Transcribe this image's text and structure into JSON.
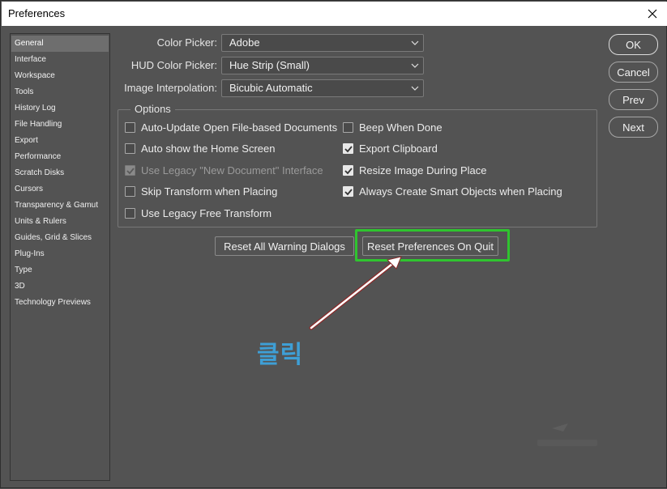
{
  "window": {
    "title": "Preferences"
  },
  "sidebar": {
    "items": [
      {
        "label": "General",
        "selected": true
      },
      {
        "label": "Interface"
      },
      {
        "label": "Workspace"
      },
      {
        "label": "Tools"
      },
      {
        "label": "History Log"
      },
      {
        "label": "File Handling"
      },
      {
        "label": "Export"
      },
      {
        "label": "Performance"
      },
      {
        "label": "Scratch Disks"
      },
      {
        "label": "Cursors"
      },
      {
        "label": "Transparency & Gamut"
      },
      {
        "label": "Units & Rulers"
      },
      {
        "label": "Guides, Grid & Slices"
      },
      {
        "label": "Plug-Ins"
      },
      {
        "label": "Type"
      },
      {
        "label": "3D"
      },
      {
        "label": "Technology Previews"
      }
    ]
  },
  "fields": {
    "color_picker": {
      "label": "Color Picker:",
      "value": "Adobe"
    },
    "hud_color_picker": {
      "label": "HUD Color Picker:",
      "value": "Hue Strip (Small)"
    },
    "image_interpolation": {
      "label": "Image Interpolation:",
      "value": "Bicubic Automatic"
    }
  },
  "options": {
    "legend": "Options",
    "left": [
      {
        "label": "Auto-Update Open File-based Documents",
        "checked": false
      },
      {
        "label": "Auto show the Home Screen",
        "checked": false
      },
      {
        "label": "Use Legacy \"New Document\" Interface",
        "checked": true,
        "disabled": true
      },
      {
        "label": "Skip Transform when Placing",
        "checked": false
      },
      {
        "label": "Use Legacy Free Transform",
        "checked": false
      }
    ],
    "right": [
      {
        "label": "Beep When Done",
        "checked": false
      },
      {
        "label": "Export Clipboard",
        "checked": true
      },
      {
        "label": "Resize Image During Place",
        "checked": true
      },
      {
        "label": "Always Create Smart Objects when Placing",
        "checked": true
      }
    ]
  },
  "buttons": {
    "reset_warnings": "Reset All Warning Dialogs",
    "reset_prefs": "Reset Preferences On Quit",
    "ok": "OK",
    "cancel": "Cancel",
    "prev": "Prev",
    "next": "Next"
  },
  "annotation": {
    "text": "클릭",
    "highlight_color": "#2fc42f",
    "text_color": "#3e9fd6"
  },
  "icons": {
    "close": "close-icon",
    "dropdown": "chevron-down-icon",
    "check": "check-icon"
  }
}
